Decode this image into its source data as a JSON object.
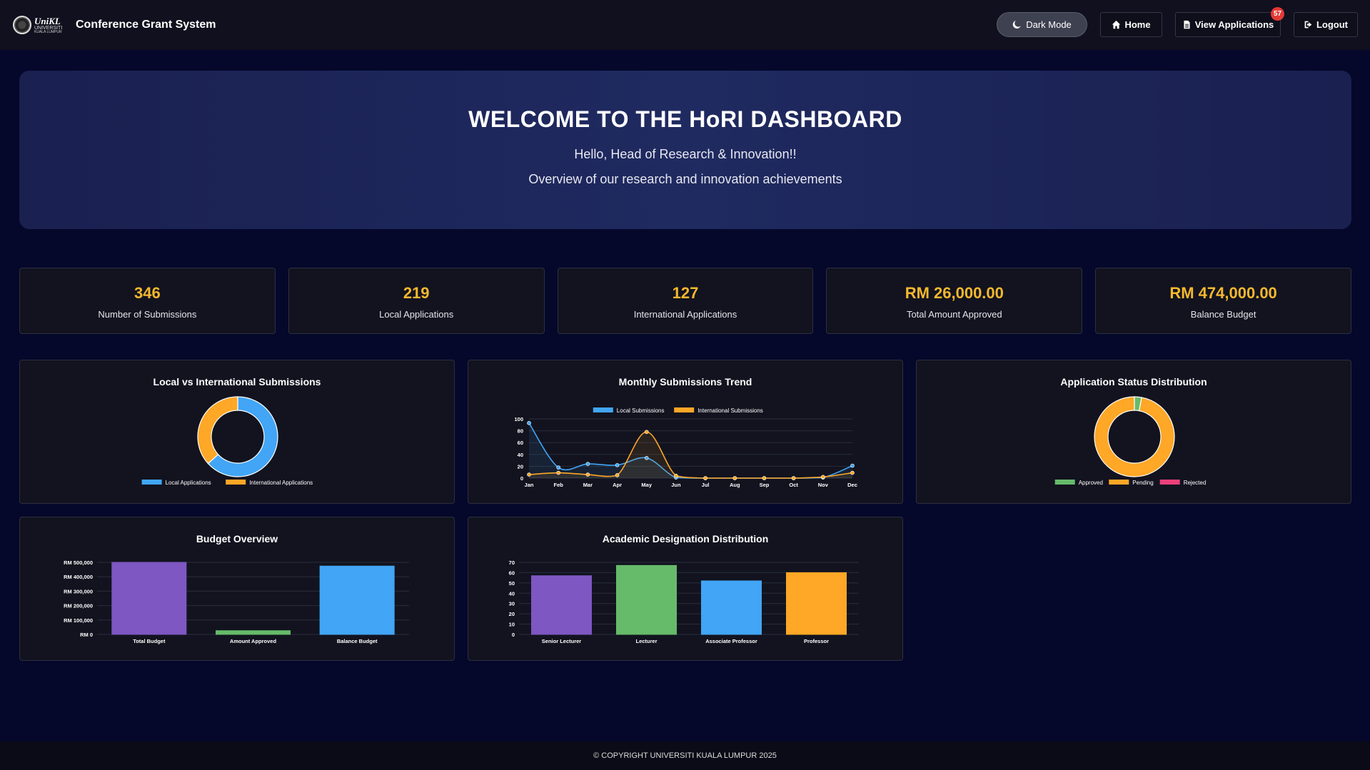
{
  "navbar": {
    "logo_line1": "UniKL",
    "logo_line2": "UNIVERSITI",
    "logo_line3": "KUALA LUMPUR",
    "app_title": "Conference Grant System",
    "dark_mode_label": "Dark Mode",
    "home_label": "Home",
    "view_applications_label": "View Applications",
    "notification_count": "57",
    "logout_label": "Logout"
  },
  "hero": {
    "title": "WELCOME TO THE HoRI DASHBOARD",
    "greeting": "Hello, Head of Research & Innovation!!",
    "subtitle": "Overview of our research and innovation achievements"
  },
  "stats": [
    {
      "value": "346",
      "label": "Number of Submissions"
    },
    {
      "value": "219",
      "label": "Local Applications"
    },
    {
      "value": "127",
      "label": "International Applications"
    },
    {
      "value": "RM 26,000.00",
      "label": "Total Amount Approved"
    },
    {
      "value": "RM 474,000.00",
      "label": "Balance Budget"
    }
  ],
  "colors": {
    "accent_yellow": "#f5b82e",
    "blue": "#42a5f5",
    "orange": "#ffa726",
    "green": "#66bb6a",
    "purple": "#7e57c2",
    "pink": "#ec407a"
  },
  "chart_data": [
    {
      "type": "pie",
      "title": "Local vs International Submissions",
      "categories": [
        "Local Applications",
        "International Applications"
      ],
      "values": [
        219,
        127
      ],
      "colors": [
        "#42a5f5",
        "#ffa726"
      ],
      "legend": "bottom"
    },
    {
      "type": "line",
      "title": "Monthly Submissions Trend",
      "x": [
        "Jan",
        "Feb",
        "Mar",
        "Apr",
        "May",
        "Jun",
        "Jul",
        "Aug",
        "Sep",
        "Oct",
        "Nov",
        "Dec"
      ],
      "series": [
        {
          "name": "Local Submissions",
          "values": [
            93,
            18,
            24,
            22,
            34,
            1,
            0,
            0,
            0,
            0,
            1,
            21
          ],
          "color": "#42a5f5"
        },
        {
          "name": "International Submissions",
          "values": [
            6,
            9,
            6,
            5,
            78,
            4,
            0,
            0,
            0,
            0,
            2,
            9
          ],
          "color": "#ffa726"
        }
      ],
      "yticks": [
        "0",
        "20",
        "40",
        "60",
        "80",
        "100"
      ],
      "ylim": [
        0,
        100
      ],
      "legend": "top"
    },
    {
      "type": "pie",
      "title": "Application Status Distribution",
      "categories": [
        "Approved",
        "Pending",
        "Rejected"
      ],
      "values": [
        10,
        336,
        0
      ],
      "colors": [
        "#66bb6a",
        "#ffa726",
        "#ec407a"
      ],
      "legend": "bottom"
    },
    {
      "type": "bar",
      "title": "Budget Overview",
      "categories": [
        "Total Budget",
        "Amount Approved",
        "Balance Budget"
      ],
      "values": [
        500000,
        26000,
        474000
      ],
      "colors": [
        "#7e57c2",
        "#66bb6a",
        "#42a5f5"
      ],
      "yticks": [
        "RM 0",
        "RM 100,000",
        "RM 200,000",
        "RM 300,000",
        "RM 400,000",
        "RM 500,000"
      ],
      "ylim": [
        0,
        500000
      ]
    },
    {
      "type": "bar",
      "title": "Academic Designation Distribution",
      "categories": [
        "Senior Lecturer",
        "Lecturer",
        "Associate Professor",
        "Professor"
      ],
      "values": [
        57,
        67,
        52,
        60
      ],
      "colors": [
        "#7e57c2",
        "#66bb6a",
        "#42a5f5",
        "#ffa726"
      ],
      "yticks": [
        "0",
        "10",
        "20",
        "30",
        "40",
        "50",
        "60",
        "70"
      ],
      "ylim": [
        0,
        70
      ]
    }
  ],
  "footer": {
    "copyright": "© COPYRIGHT UNIVERSITI KUALA LUMPUR 2025"
  }
}
